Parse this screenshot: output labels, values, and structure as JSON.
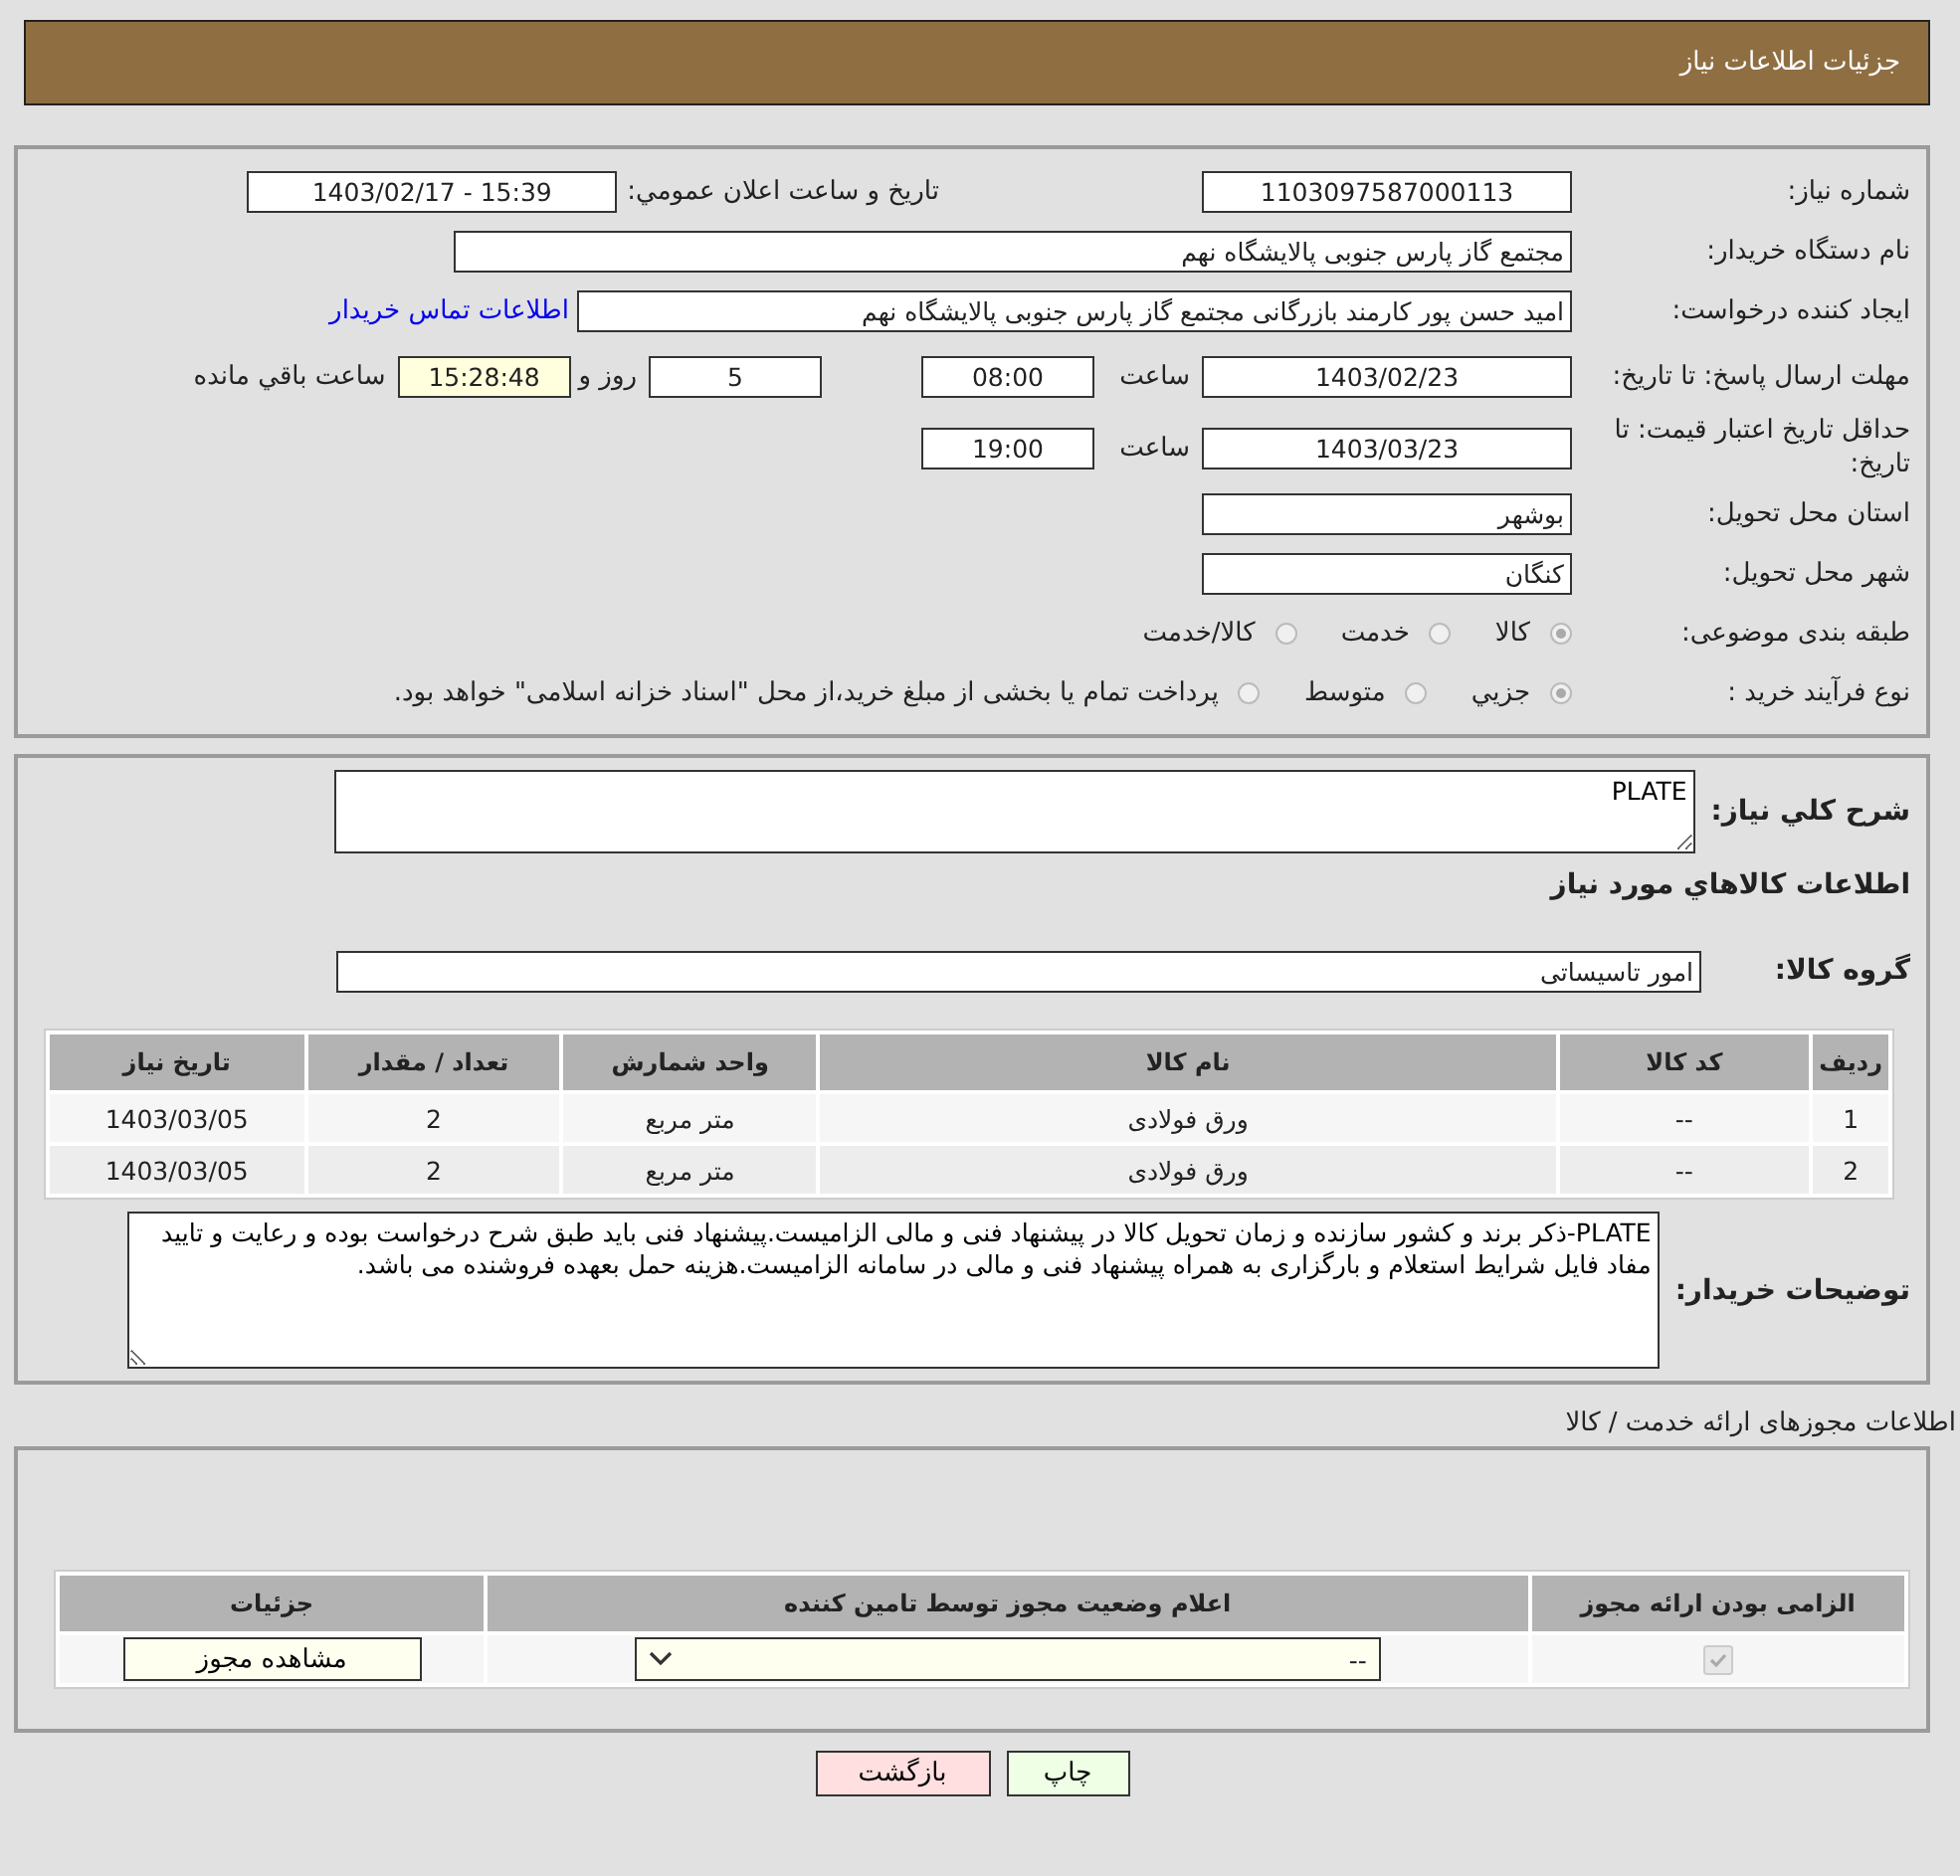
{
  "header": {
    "title": "جزئیات اطلاعات نیاز"
  },
  "details": {
    "need_number": {
      "label": "شماره نیاز:",
      "value": "1103097587000113"
    },
    "announce": {
      "label": "تاریخ و ساعت اعلان عمومي:",
      "value": "1403/02/17 - 15:39"
    },
    "buyer": {
      "label": "نام دستگاه خریدار:",
      "value": "مجتمع گاز پارس جنوبی  پالایشگاه نهم"
    },
    "creator": {
      "label": "ایجاد کننده درخواست:",
      "value": "امید حسن پور کارمند بازرگانی مجتمع گاز پارس جنوبی  پالایشگاه نهم",
      "link": "اطلاعات تماس خریدار"
    },
    "reply_deadline": {
      "label": "مهلت ارسال پاسخ: تا تاریخ:",
      "date": "1403/02/23",
      "time_label": "ساعت",
      "time": "08:00",
      "days": "5",
      "days_label": "روز و",
      "remaining": "15:28:48",
      "remaining_label": "ساعت باقي مانده"
    },
    "price_validity": {
      "label": "حداقل تاریخ اعتبار قیمت: تا تاریخ:",
      "date": "1403/03/23",
      "time_label": "ساعت",
      "time": "19:00"
    },
    "province": {
      "label": "استان محل تحویل:",
      "value": "بوشهر"
    },
    "city": {
      "label": "شهر محل تحویل:",
      "value": "کنگان"
    },
    "category": {
      "label": "طبقه بندی موضوعی:",
      "options": [
        {
          "label": "کالا",
          "selected": true
        },
        {
          "label": "خدمت",
          "selected": false
        },
        {
          "label": "کالا/خدمت",
          "selected": false
        }
      ]
    },
    "purchase_type": {
      "label": "نوع فرآیند خرید :",
      "options": [
        {
          "label": "جزيي",
          "selected": true
        },
        {
          "label": "متوسط",
          "selected": false
        },
        {
          "label": "پرداخت تمام یا بخشی از مبلغ خرید،از محل \"اسناد خزانه اسلامی\" خواهد بود.",
          "selected": false
        }
      ]
    }
  },
  "description": {
    "label": "شرح کلي نیاز:",
    "value": "PLATE",
    "items_title": "اطلاعات کالاهاي مورد نیاز",
    "group_label": "گروه کالا:",
    "group": "امور تاسیساتی"
  },
  "items_table": {
    "columns": [
      "ردیف",
      "کد کالا",
      "نام کالا",
      "واحد شمارش",
      "تعداد / مقدار",
      "تاریخ نیاز"
    ],
    "rows": [
      [
        "1",
        "--",
        "ورق فولادی",
        "متر مربع",
        "2",
        "1403/03/05"
      ],
      [
        "2",
        "--",
        "ورق فولادی",
        "متر مربع",
        "2",
        "1403/03/05"
      ]
    ]
  },
  "buyer_notes": {
    "label": "توضیحات خریدار:",
    "value": "PLATE-ذکر برند و کشور سازنده و زمان تحویل کالا در پیشنهاد فنی و مالی الزامیست.پیشنهاد فنی باید طبق شرح درخواست بوده و رعایت و تایید مفاد فایل شرایط استعلام و بارگزاری به همراه پیشنهاد فنی و مالی در سامانه الزامیست.هزینه حمل بعهده فروشنده می باشد."
  },
  "permits": {
    "title": "اطلاعات مجوزهای ارائه خدمت / کالا",
    "columns": [
      "الزامی بودن ارائه مجوز",
      "اعلام وضعیت مجوز توسط تامین کننده",
      "جزئیات"
    ],
    "rows": [
      {
        "required": true,
        "status": "--",
        "button": "مشاهده مجوز"
      }
    ]
  },
  "buttons": [
    {
      "label": "چاپ",
      "kind": "print"
    },
    {
      "label": "بازگشت",
      "kind": "back"
    }
  ]
}
